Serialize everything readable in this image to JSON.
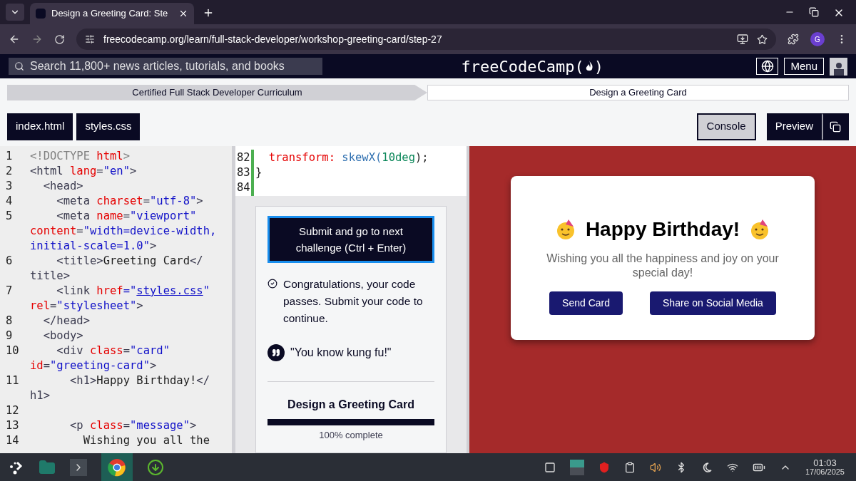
{
  "browser": {
    "tabs": [
      {
        "title": "Design a Greeting Card: Ste",
        "selected": true
      }
    ],
    "address": "freecodecamp.org/learn/full-stack-developer/workshop-greeting-card/step-27",
    "profile": "G"
  },
  "site_nav": {
    "search_placeholder": "Search 11,800+ news articles, tutorials, and books",
    "logo_before": "freeCodeCamp(",
    "logo_after": ")",
    "menu": "Menu"
  },
  "breadcrumb": [
    {
      "label": "Certified Full Stack Developer Curriculum",
      "kind": "parent"
    },
    {
      "label": "Design a Greeting Card",
      "kind": "current"
    }
  ],
  "file_tabs": [
    "index.html",
    "styles.css"
  ],
  "panel_buttons": [
    {
      "label": "Console",
      "kind": "light"
    },
    {
      "label": "Preview",
      "kind": "dark"
    }
  ],
  "html_editor": [
    {
      "number": "1",
      "tokens": [
        {
          "t": "<!DOCTYPE ",
          "kind": "meta"
        },
        {
          "t": "html",
          "kind": "attr"
        },
        {
          "t": ">",
          "kind": "meta"
        }
      ]
    },
    {
      "number": "2",
      "tokens": [
        {
          "t": "<html ",
          "kind": "tag"
        },
        {
          "t": "lang",
          "kind": "attr"
        },
        {
          "t": "=",
          "kind": "tag"
        },
        {
          "t": "\"en\"",
          "kind": "value"
        },
        {
          "t": ">",
          "kind": "tag"
        }
      ]
    },
    {
      "number": "3",
      "tokens": [
        {
          "t": "  <head>",
          "kind": "tag"
        }
      ]
    },
    {
      "number": "4",
      "tokens": [
        {
          "t": "    <meta ",
          "kind": "tag"
        },
        {
          "t": "charset",
          "kind": "attr"
        },
        {
          "t": "=",
          "kind": "tag"
        },
        {
          "t": "\"utf-8\"",
          "kind": "value"
        },
        {
          "t": ">",
          "kind": "tag"
        }
      ]
    },
    {
      "number": "5",
      "tokens": [
        {
          "t": "    <meta ",
          "kind": "tag"
        },
        {
          "t": "name",
          "kind": "attr"
        },
        {
          "t": "=",
          "kind": "tag"
        },
        {
          "t": "\"viewport\"",
          "kind": "value"
        }
      ]
    },
    {
      "tokens": [
        {
          "t": "content",
          "kind": "attr"
        },
        {
          "t": "=",
          "kind": "tag"
        },
        {
          "t": "\"width=device-width,",
          "kind": "value"
        }
      ]
    },
    {
      "tokens": [
        {
          "t": "initial-scale=1.0\"",
          "kind": "value"
        },
        {
          "t": ">",
          "kind": "tag"
        }
      ]
    },
    {
      "number": "6",
      "tokens": [
        {
          "t": "    <title>",
          "kind": "tag"
        },
        {
          "t": "Greeting Card",
          "kind": "text"
        },
        {
          "t": "</",
          "kind": "tag"
        }
      ]
    },
    {
      "tokens": [
        {
          "t": "title>",
          "kind": "tag"
        }
      ]
    },
    {
      "number": "7",
      "tokens": [
        {
          "t": "    <link ",
          "kind": "tag"
        },
        {
          "t": "href",
          "kind": "attr"
        },
        {
          "t": "=\"",
          "kind": "value"
        },
        {
          "t": "styles.css",
          "kind": "link"
        },
        {
          "t": "\"",
          "kind": "value"
        }
      ]
    },
    {
      "tokens": [
        {
          "t": "rel",
          "kind": "attr"
        },
        {
          "t": "=",
          "kind": "tag"
        },
        {
          "t": "\"stylesheet\"",
          "kind": "value"
        },
        {
          "t": ">",
          "kind": "tag"
        }
      ]
    },
    {
      "number": "8",
      "tokens": [
        {
          "t": "  </head>",
          "kind": "tag"
        }
      ]
    },
    {
      "number": "9",
      "tokens": [
        {
          "t": "  <body>",
          "kind": "tag"
        }
      ]
    },
    {
      "number": "10",
      "tokens": [
        {
          "t": "    <div ",
          "kind": "tag"
        },
        {
          "t": "class",
          "kind": "attr"
        },
        {
          "t": "=",
          "kind": "tag"
        },
        {
          "t": "\"card\"",
          "kind": "value"
        }
      ]
    },
    {
      "tokens": [
        {
          "t": "id",
          "kind": "attr"
        },
        {
          "t": "=",
          "kind": "tag"
        },
        {
          "t": "\"greeting-card\"",
          "kind": "value"
        },
        {
          "t": ">",
          "kind": "tag"
        }
      ]
    },
    {
      "number": "11",
      "tokens": [
        {
          "t": "      <h1>",
          "kind": "tag"
        },
        {
          "t": "Happy Birthday!",
          "kind": "text"
        },
        {
          "t": "</",
          "kind": "tag"
        }
      ]
    },
    {
      "tokens": [
        {
          "t": "h1>",
          "kind": "tag"
        }
      ]
    },
    {
      "number": "12"
    },
    {
      "number": "13",
      "tokens": [
        {
          "t": "      <p ",
          "kind": "tag"
        },
        {
          "t": "class",
          "kind": "attr"
        },
        {
          "t": "=",
          "kind": "tag"
        },
        {
          "t": "\"message\"",
          "kind": "value"
        },
        {
          "t": ">",
          "kind": "tag"
        }
      ]
    },
    {
      "number": "14",
      "tokens": [
        {
          "t": "        Wishing you all the",
          "kind": "text"
        }
      ]
    }
  ],
  "css_editor": [
    {
      "number": "82",
      "tokens": [
        {
          "t": "  transform: ",
          "kind": "prop"
        },
        {
          "t": "skewX(",
          "kind": "func"
        },
        {
          "t": "10deg",
          "kind": "num"
        },
        {
          "t": ");",
          "kind": "text"
        }
      ]
    },
    {
      "number": "83",
      "tokens": [
        {
          "t": "}",
          "kind": "text"
        }
      ]
    },
    {
      "number": "84"
    }
  ],
  "lesson": {
    "submit": "Submit and go to next challenge (Ctrl + Enter)",
    "success": "Congratulations, your code passes. Submit your code to continue.",
    "quote": "\"You know kung fu!\"",
    "title": "Design a Greeting Card",
    "level": 1,
    "progress_text": "100% complete"
  },
  "preview_card": {
    "heading": "Happy Birthday!",
    "message": "Wishing you all the happiness and joy on your special day!",
    "buttons": [
      "Send Card",
      "Share on Social Media"
    ]
  },
  "taskbar": {
    "time": "01:03",
    "date": "17/06/2025"
  }
}
